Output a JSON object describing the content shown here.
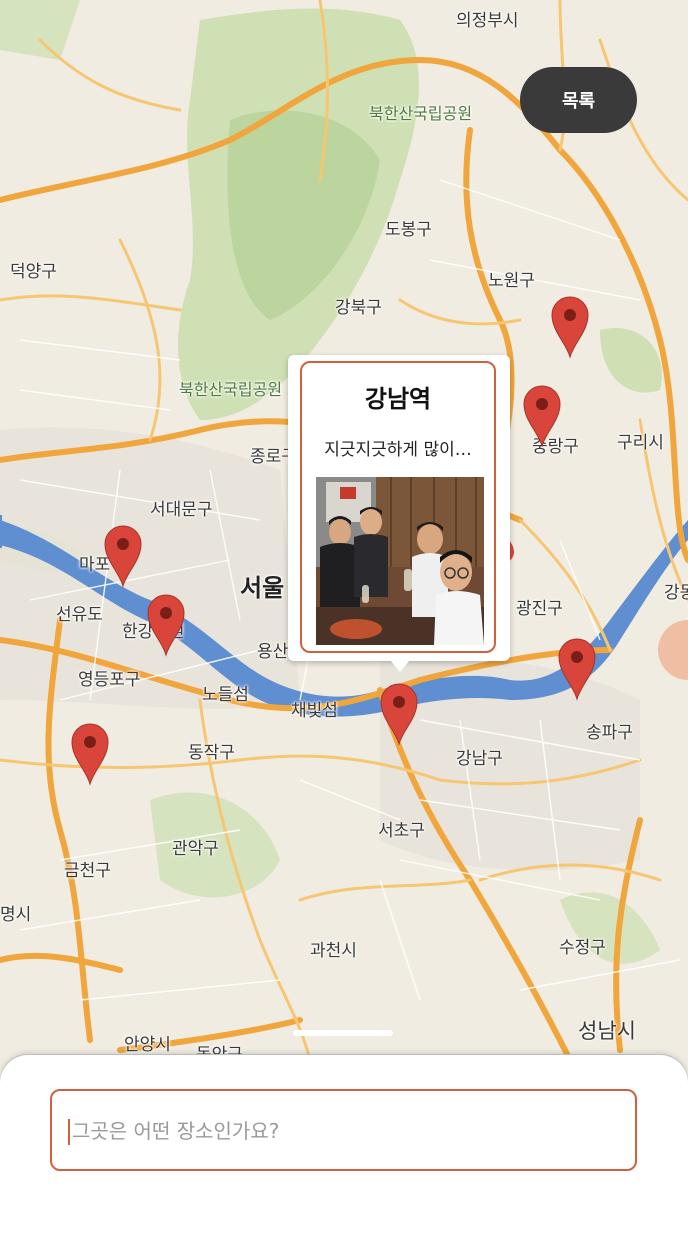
{
  "header": {
    "list_button_label": "목록"
  },
  "map": {
    "districts": [
      {
        "id": "uijeongbu",
        "name": "의정부시"
      },
      {
        "id": "bukhansan-top",
        "name": "북한산국립공원"
      },
      {
        "id": "deogyang",
        "name": "덕양구"
      },
      {
        "id": "dobong",
        "name": "도봉구"
      },
      {
        "id": "nowon",
        "name": "노원구"
      },
      {
        "id": "gangbuk",
        "name": "강북구"
      },
      {
        "id": "bukhansan-mid",
        "name": "북한산국립공원"
      },
      {
        "id": "guri",
        "name": "구리시"
      },
      {
        "id": "jungnang",
        "name": "중랑구"
      },
      {
        "id": "jongno",
        "name": "종로구"
      },
      {
        "id": "seodaemun",
        "name": "서대문구"
      },
      {
        "id": "mapo",
        "name": "마포구"
      },
      {
        "id": "seoul",
        "name": "서울"
      },
      {
        "id": "seonyudo",
        "name": "선유도"
      },
      {
        "id": "hangang",
        "name": "한강공원"
      },
      {
        "id": "yongsan",
        "name": "용산구"
      },
      {
        "id": "gwangjin",
        "name": "광진구"
      },
      {
        "id": "gangdong",
        "name": "강동구"
      },
      {
        "id": "yeongdeungpo",
        "name": "영등포구"
      },
      {
        "id": "nodeulseom",
        "name": "노들섬"
      },
      {
        "id": "saebitseom",
        "name": "채빛섬"
      },
      {
        "id": "songpa",
        "name": "송파구"
      },
      {
        "id": "dongjak",
        "name": "동작구"
      },
      {
        "id": "gangnam",
        "name": "강남구"
      },
      {
        "id": "seocho",
        "name": "서초구"
      },
      {
        "id": "gwanak",
        "name": "관악구"
      },
      {
        "id": "geumcheon",
        "name": "금천구"
      },
      {
        "id": "gwangmyeong",
        "name": "명시"
      },
      {
        "id": "sujeong",
        "name": "수정구"
      },
      {
        "id": "gwacheon",
        "name": "과천시"
      },
      {
        "id": "anyang",
        "name": "안양시"
      },
      {
        "id": "dongan",
        "name": "동안구"
      },
      {
        "id": "seongnam",
        "name": "성남시"
      }
    ],
    "accent_color": "#d0613f",
    "marker_color": "#d9453b"
  },
  "popup": {
    "title": "강남역",
    "description": "지긋지긋하게 많이…",
    "photo": "group-photo"
  },
  "bottom_sheet": {
    "input_placeholder": "그곳은 어떤 장소인가요?",
    "input_value": ""
  }
}
